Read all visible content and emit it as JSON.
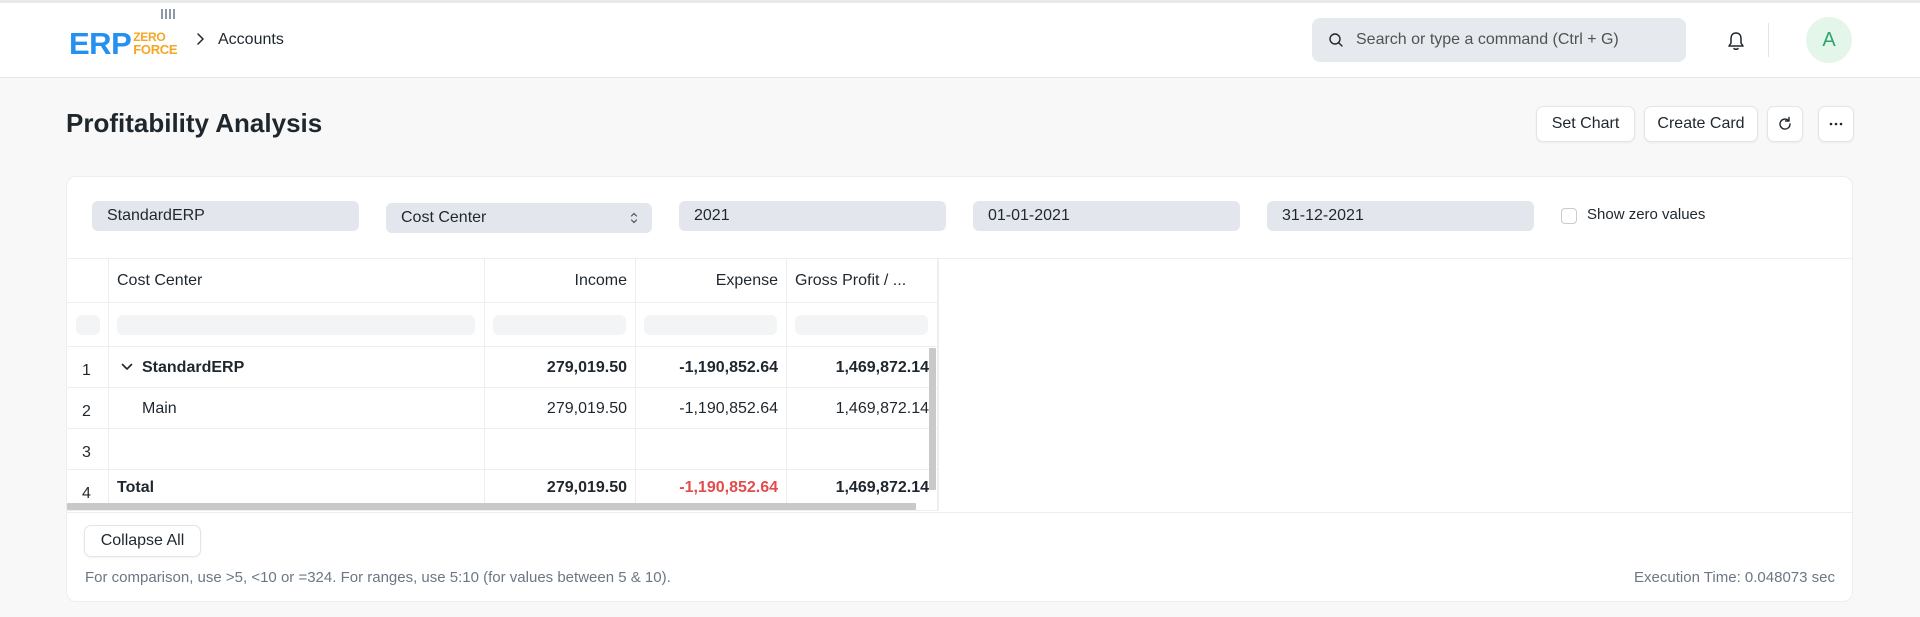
{
  "navbar": {
    "logo": {
      "erp": "ERP",
      "zero": "ZERO",
      "force": "FORCE"
    },
    "breadcrumb": "Accounts",
    "search_placeholder": "Search or type a command (Ctrl + G)",
    "avatar_initial": "A"
  },
  "page": {
    "title": "Profitability Analysis",
    "buttons": {
      "set_chart": "Set Chart",
      "create_card": "Create Card"
    }
  },
  "filters": {
    "company": "StandardERP",
    "based_on": "Cost Center",
    "fiscal_year": "2021",
    "from_date": "01-01-2021",
    "to_date": "31-12-2021",
    "show_zero_values_label": "Show zero values",
    "show_zero_values": false
  },
  "table": {
    "columns": [
      "Cost Center",
      "Income",
      "Expense",
      "Gross Profit / ..."
    ],
    "rows": [
      {
        "num": "1",
        "name": "StandardERP",
        "income": "279,019.50",
        "expense": "-1,190,852.64",
        "profit": "1,469,872.14"
      },
      {
        "num": "2",
        "name": "Main",
        "income": "279,019.50",
        "expense": "-1,190,852.64",
        "profit": "1,469,872.14"
      },
      {
        "num": "3",
        "name": "",
        "income": "",
        "expense": "",
        "profit": ""
      },
      {
        "num": "4",
        "name": "Total",
        "income": "279,019.50",
        "expense": "-1,190,852.64",
        "profit": "1,469,872.14"
      }
    ]
  },
  "footer": {
    "collapse_all": "Collapse All",
    "help": "For comparison, use >5, <10 or =324. For ranges, use 5:10 (for values between 5 & 10).",
    "execution_time": "Execution Time: 0.048073 sec"
  },
  "colors": {
    "accent": "#2490ef",
    "logo_orange": "#f5a623",
    "negative": "#e24c4c",
    "avatar_green": "#30a66d"
  }
}
